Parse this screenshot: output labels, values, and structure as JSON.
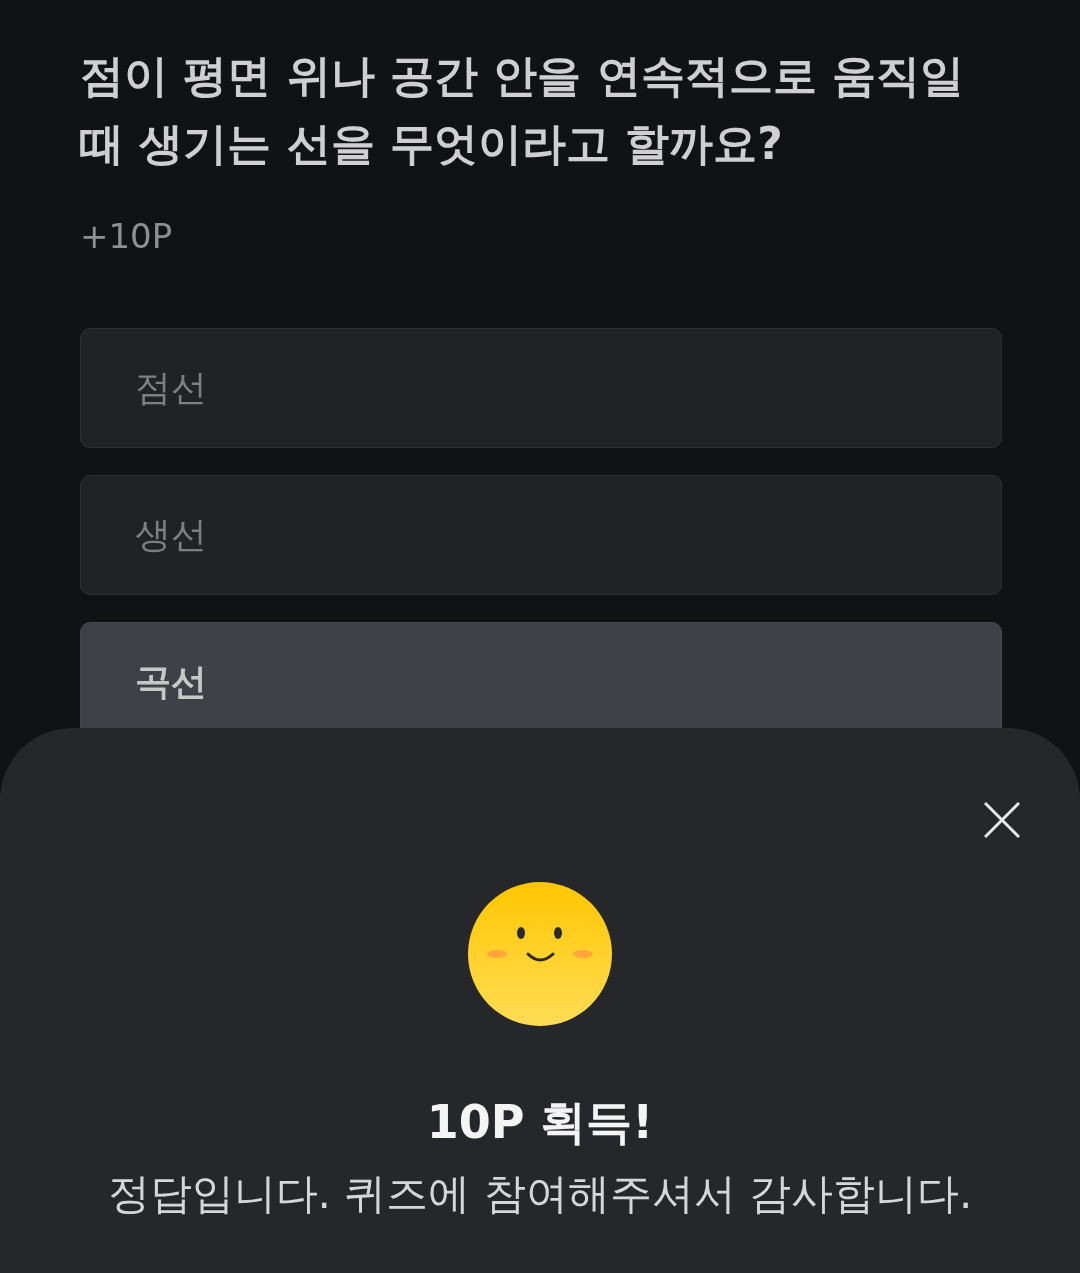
{
  "question": "점이 평면 위나 공간 안을 연속적으로 움직일 때 생기는 선을 무엇이라고 할까요?",
  "points": "+10P",
  "options": [
    {
      "label": "점선",
      "selected": false
    },
    {
      "label": "생선",
      "selected": false
    },
    {
      "label": "곡선",
      "selected": true
    }
  ],
  "result_sheet": {
    "title": "10P 획득!",
    "message": "정답입니다. 퀴즈에 참여해주셔서 감사합니다."
  }
}
